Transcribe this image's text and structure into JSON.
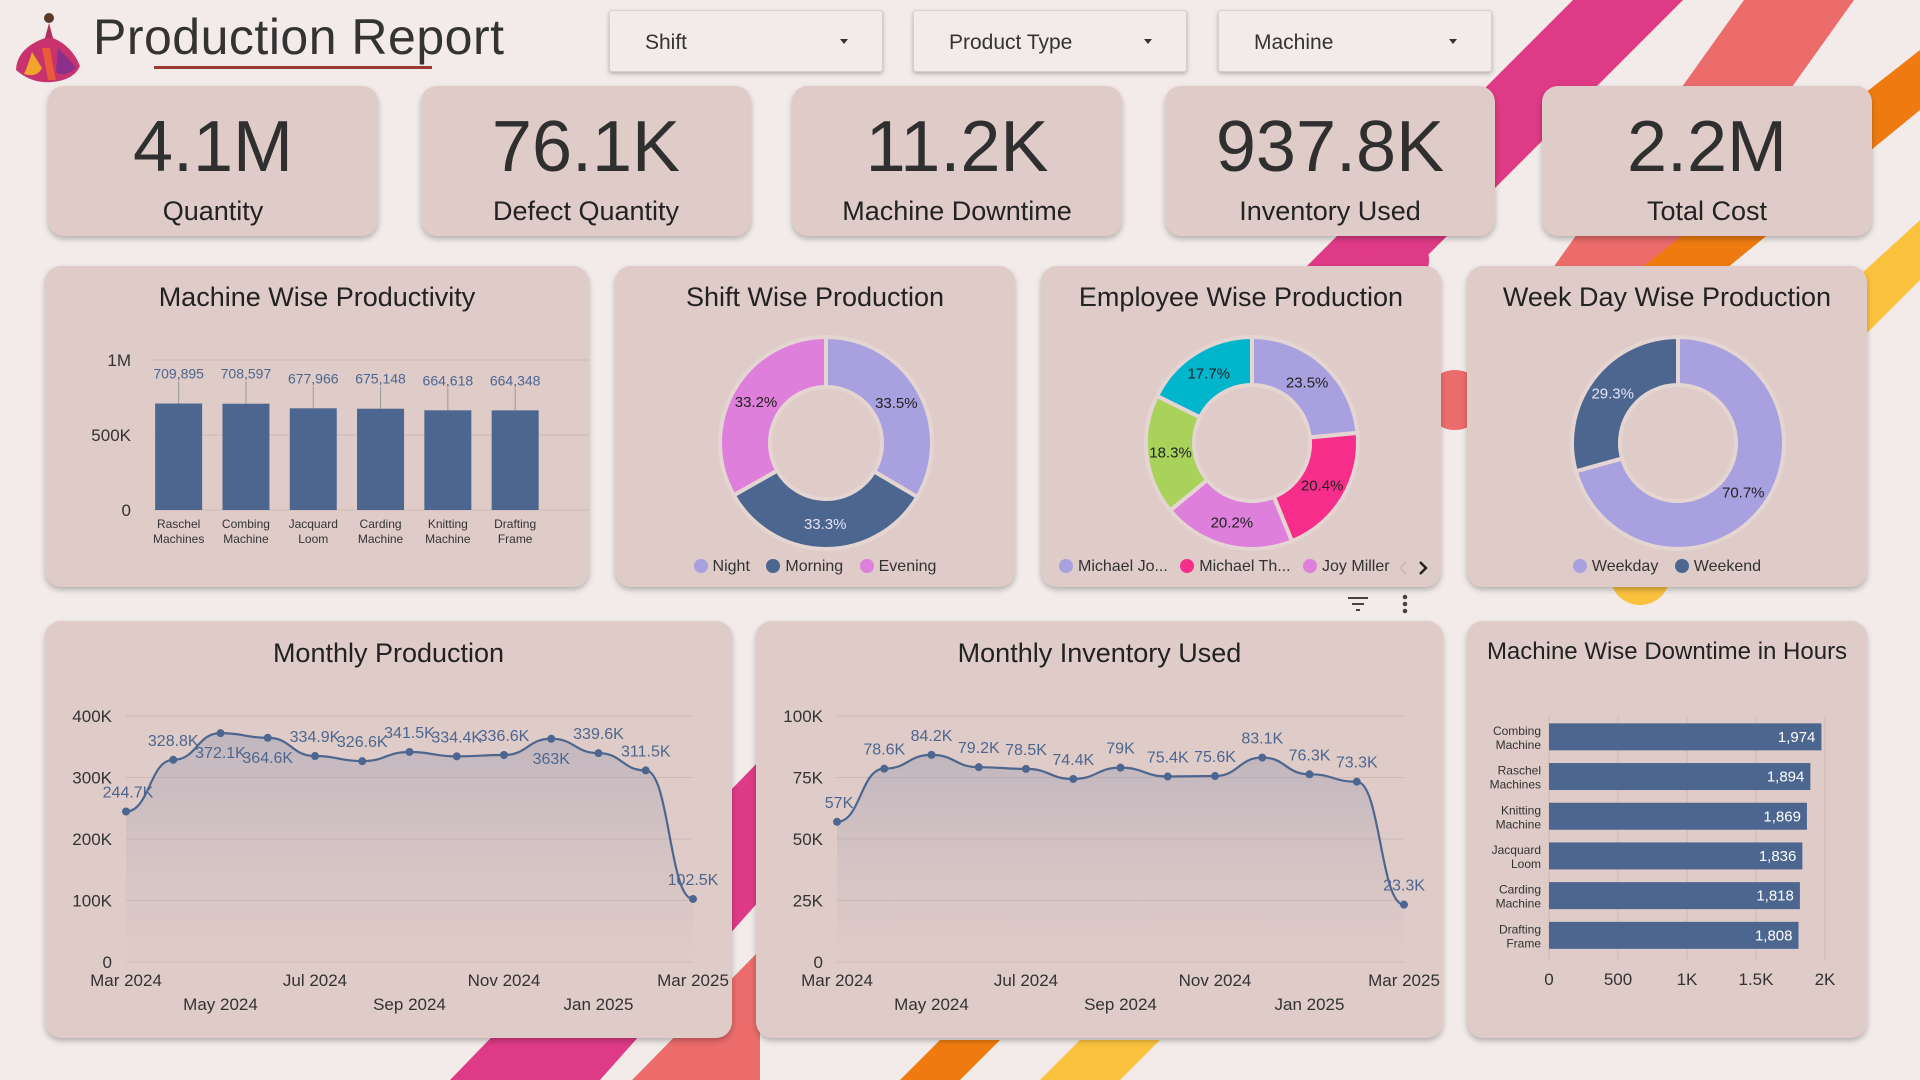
{
  "header": {
    "title": "Production Report",
    "filters": [
      {
        "label": "Shift"
      },
      {
        "label": "Product Type"
      },
      {
        "label": "Machine"
      }
    ]
  },
  "kpis": [
    {
      "value": "4.1M",
      "label": "Quantity"
    },
    {
      "value": "76.1K",
      "label": "Defect Quantity"
    },
    {
      "value": "11.2K",
      "label": "Machine Downtime"
    },
    {
      "value": "937.8K",
      "label": "Inventory Used"
    },
    {
      "value": "2.2M",
      "label": "Total Cost"
    }
  ],
  "colors": {
    "bar": "#4c6690",
    "card": "#dfcbc7",
    "lavender": "#a8a0df",
    "navy": "#4c6690",
    "orchid": "#de7fdc",
    "pink": "#f72d8c",
    "cyan": "#00b5cc",
    "green": "#a8d25a"
  },
  "chart_data": [
    {
      "id": "machine_productivity",
      "type": "bar",
      "title": "Machine Wise Productivity",
      "categories": [
        "Raschel Machines",
        "Combing Machine",
        "Jacquard Loom",
        "Carding Machine",
        "Knitting Machine",
        "Drafting Frame"
      ],
      "values": [
        709895,
        708597,
        677966,
        675148,
        664618,
        664348
      ],
      "data_labels": [
        "709,895",
        "708,597",
        "677,966",
        "675,148",
        "664,618",
        "664,348"
      ],
      "ylim": [
        0,
        1000000
      ],
      "yticks": [
        "0",
        "500K",
        "1M"
      ],
      "grid": true
    },
    {
      "id": "shift_production",
      "type": "pie",
      "title": "Shift Wise Production",
      "slices": [
        {
          "name": "Night",
          "value": 33.5,
          "label": "33.5%",
          "color": "#a8a0df"
        },
        {
          "name": "Morning",
          "value": 33.3,
          "label": "33.3%",
          "color": "#4c6690"
        },
        {
          "name": "Evening",
          "value": 33.2,
          "label": "33.2%",
          "color": "#de7fdc"
        }
      ],
      "legend": "bottom"
    },
    {
      "id": "employee_production",
      "type": "pie",
      "title": "Employee Wise Production",
      "slices": [
        {
          "name": "Michael Jo...",
          "value": 23.5,
          "label": "23.5%",
          "color": "#a8a0df"
        },
        {
          "name": "Michael Th...",
          "value": 20.4,
          "label": "20.4%",
          "color": "#f72d8c"
        },
        {
          "name": "Joy Miller",
          "value": 20.2,
          "label": "20.2%",
          "color": "#de7fdc"
        },
        {
          "name": "",
          "value": 18.3,
          "label": "18.3%",
          "color": "#a8d25a"
        },
        {
          "name": "",
          "value": 17.7,
          "label": "17.7%",
          "color": "#00b5cc"
        }
      ],
      "legend": "bottom"
    },
    {
      "id": "weekday_production",
      "type": "pie",
      "title": "Week Day Wise Production",
      "slices": [
        {
          "name": "Weekday",
          "value": 70.7,
          "label": "70.7%",
          "color": "#a8a0df"
        },
        {
          "name": "Weekend",
          "value": 29.3,
          "label": "29.3%",
          "color": "#4c6690"
        }
      ],
      "legend": "bottom"
    },
    {
      "id": "monthly_production",
      "type": "area",
      "title": "Monthly Production",
      "x": [
        "2024-03",
        "2024-04",
        "2024-05",
        "2024-06",
        "2024-07",
        "2024-08",
        "2024-09",
        "2024-10",
        "2024-11",
        "2024-12",
        "2025-01",
        "2025-02",
        "2025-03"
      ],
      "values": [
        244700,
        328800,
        372100,
        364600,
        334900,
        326600,
        341500,
        334400,
        336600,
        363000,
        339600,
        311500,
        102500
      ],
      "data_labels": [
        "244.7K",
        "328.8K",
        "372.1K",
        "364.6K",
        "334.9K",
        "326.6K",
        "341.5K",
        "334.4K",
        "336.6K",
        "363K",
        "339.6K",
        "311.5K",
        "102.5K"
      ],
      "label_below": [
        false,
        false,
        true,
        true,
        false,
        false,
        false,
        false,
        false,
        true,
        false,
        false,
        false
      ],
      "ylim": [
        0,
        400000
      ],
      "yticks": [
        "0",
        "100K",
        "200K",
        "300K",
        "400K"
      ],
      "xticks_top": [
        "Mar 2024",
        "Jul 2024",
        "Nov 2024",
        "Mar 2025"
      ],
      "xticks_bottom": [
        "May 2024",
        "Sep 2024",
        "Jan 2025"
      ],
      "grid": true
    },
    {
      "id": "monthly_inventory",
      "type": "area",
      "title": "Monthly Inventory Used",
      "x": [
        "2024-03",
        "2024-04",
        "2024-05",
        "2024-06",
        "2024-07",
        "2024-08",
        "2024-09",
        "2024-10",
        "2024-11",
        "2024-12",
        "2025-01",
        "2025-02",
        "2025-03"
      ],
      "values": [
        57000,
        78600,
        84200,
        79200,
        78500,
        74400,
        79000,
        75400,
        75600,
        83100,
        76300,
        73300,
        23300
      ],
      "data_labels": [
        "57K",
        "78.6K",
        "84.2K",
        "79.2K",
        "78.5K",
        "74.4K",
        "79K",
        "75.4K",
        "75.6K",
        "83.1K",
        "76.3K",
        "73.3K",
        "23.3K"
      ],
      "label_below": [
        false,
        false,
        false,
        false,
        false,
        false,
        false,
        false,
        false,
        false,
        false,
        false,
        false
      ],
      "ylim": [
        0,
        100000
      ],
      "yticks": [
        "0",
        "25K",
        "50K",
        "75K",
        "100K"
      ],
      "xticks_top": [
        "Mar 2024",
        "Jul 2024",
        "Nov 2024",
        "Mar 2025"
      ],
      "xticks_bottom": [
        "May 2024",
        "Sep 2024",
        "Jan 2025"
      ],
      "grid": true
    },
    {
      "id": "machine_downtime",
      "type": "bar",
      "orientation": "horizontal",
      "title": "Machine Wise Downtime in Hours",
      "categories": [
        "Combing Machine",
        "Raschel Machines",
        "Knitting Machine",
        "Jacquard Loom",
        "Carding Machine",
        "Drafting Frame"
      ],
      "values": [
        1974,
        1894,
        1869,
        1836,
        1818,
        1808
      ],
      "data_labels": [
        "1,974",
        "1,894",
        "1,869",
        "1,836",
        "1,818",
        "1,808"
      ],
      "xlim": [
        0,
        2000
      ],
      "xticks": [
        "0",
        "500",
        "1K",
        "1.5K",
        "2K"
      ],
      "grid": true
    }
  ]
}
